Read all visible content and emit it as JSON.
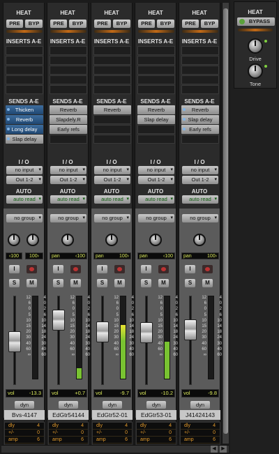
{
  "section_labels": {
    "heat": "HEAT",
    "inserts": "INSERTS A-E",
    "sends": "SENDS A-E",
    "io": "I / O",
    "auto": "AUTO"
  },
  "heat_buttons": {
    "pre": "PRE",
    "byp": "BYP"
  },
  "strip_buttons": {
    "input": "I",
    "solo": "S",
    "mute": "M",
    "dyn": "dyn"
  },
  "comment_keys": [
    "dly",
    "+/-",
    "amp"
  ],
  "strips": [
    {
      "sends": [
        {
          "label": "Thicken",
          "style": "blue"
        },
        {
          "label": "Reverb",
          "style": "blue"
        },
        {
          "label": "Long delay",
          "style": "blue"
        },
        {
          "label": "Slap delay",
          "style": "grey-dot"
        }
      ],
      "input": "no input",
      "output": "Out 1-2",
      "auto": "auto read",
      "group": "no group",
      "pan": {
        "left": "‹100",
        "right": "100›",
        "stereo": true
      },
      "vol": "-13.3",
      "name": "Bvs-4147",
      "fader": 0.52,
      "meter": 0.0,
      "comments": [
        {
          "k": "dly",
          "v": "4"
        },
        {
          "k": "+/-",
          "v": "0"
        },
        {
          "k": "amp",
          "v": "6"
        }
      ]
    },
    {
      "sends": [
        {
          "label": "Reverb",
          "style": "grey"
        },
        {
          "label": "Slapdely.R",
          "style": "grey"
        },
        {
          "label": "Early refs",
          "style": "grey"
        },
        {
          "label": "",
          "style": "dark"
        }
      ],
      "input": "no input",
      "output": "Out 1-2",
      "auto": "auto read",
      "group": "no group",
      "pan": {
        "label": "pan",
        "value": "‹100",
        "stereo": false
      },
      "vol": "+0.7",
      "name": "EdGtr54144",
      "fader": 0.2,
      "meter": 0.13,
      "comments": [
        {
          "k": "dly",
          "v": "4"
        },
        {
          "k": "+/-",
          "v": "0"
        },
        {
          "k": "amp",
          "v": "6"
        }
      ]
    },
    {
      "sends": [
        {
          "label": "Reverb",
          "style": "grey"
        },
        {
          "label": "",
          "style": "dark"
        },
        {
          "label": "",
          "style": "dark"
        },
        {
          "label": "",
          "style": "dark"
        }
      ],
      "input": "no input",
      "output": "Out 1-2",
      "auto": "auto read",
      "group": "no group",
      "pan": {
        "label": "pan",
        "value": "100›",
        "stereo": false
      },
      "vol": "-9.7",
      "name": "EdGtr52-01",
      "fader": 0.38,
      "meter": 0.65,
      "comments": [
        {
          "k": "dly",
          "v": "4"
        },
        {
          "k": "+/-",
          "v": "0"
        },
        {
          "k": "amp",
          "v": "6"
        }
      ]
    },
    {
      "sends": [
        {
          "label": "Reverb",
          "style": "grey"
        },
        {
          "label": "Slap delay",
          "style": "grey"
        },
        {
          "label": "",
          "style": "dark"
        },
        {
          "label": "",
          "style": "dark"
        }
      ],
      "input": "no input",
      "output": "Out 1-2",
      "auto": "auto read",
      "group": "no group",
      "pan": {
        "label": "pan",
        "value": "‹100",
        "stereo": false
      },
      "vol": "-10.2",
      "name": "EdGtr53-01",
      "fader": 0.39,
      "meter": 0.45,
      "comments": [
        {
          "k": "dly",
          "v": "4"
        },
        {
          "k": "+/-",
          "v": "0"
        },
        {
          "k": "amp",
          "v": "6"
        }
      ]
    },
    {
      "sends": [
        {
          "label": "Reverb",
          "style": "grey-dot"
        },
        {
          "label": "Slap delay",
          "style": "grey-dot"
        },
        {
          "label": "Early refs",
          "style": "grey-dot"
        },
        {
          "label": "",
          "style": "dark"
        }
      ],
      "input": "no input",
      "output": "Out 1-2",
      "auto": "auto read",
      "group": "no group",
      "pan": {
        "label": "pan",
        "value": "100›",
        "stereo": false
      },
      "vol": "-9.8",
      "name": "J41424143",
      "fader": 0.35,
      "meter": 0.0,
      "comments": [
        {
          "k": "dly",
          "v": "4"
        },
        {
          "k": "+/-",
          "v": "0"
        },
        {
          "k": "amp",
          "v": "6"
        }
      ]
    }
  ],
  "fader_scale": [
    "12",
    "6",
    "0",
    "5",
    "10",
    "15",
    "20",
    "30",
    "40",
    "60",
    "∞"
  ],
  "meter_scale": [
    "4",
    "0",
    "2",
    "6",
    "10",
    "14",
    "18",
    "24",
    "30",
    "40",
    "60"
  ],
  "plugin": {
    "title": "HEAT",
    "bypass": "BYPASS",
    "knob1": "Drive",
    "knob2": "Tone"
  },
  "colors": {
    "accent_green": "#79c331",
    "accent_orange": "#c26a17",
    "readout_yellow": "#d9e85c"
  }
}
